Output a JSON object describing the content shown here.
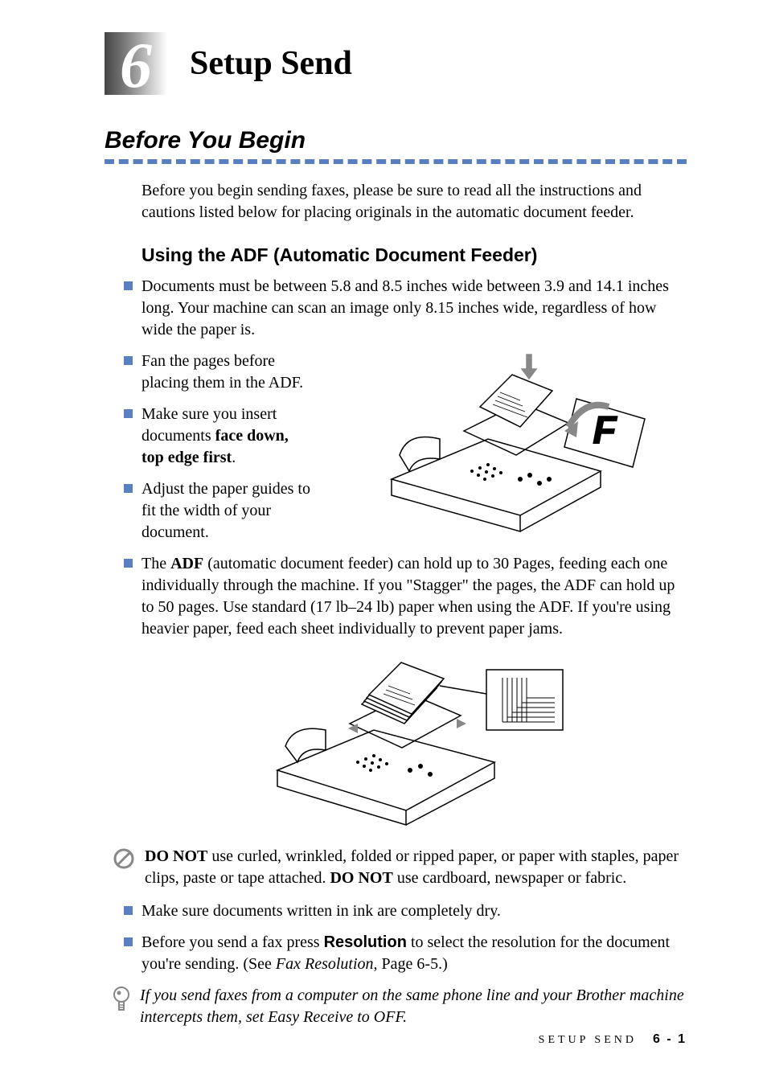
{
  "chapter": {
    "number": "6",
    "title": "Setup Send"
  },
  "section": {
    "title": "Before You Begin",
    "intro": "Before you begin sending faxes, please be sure to read all the instructions and cautions listed below for placing originals in the automatic document feeder."
  },
  "subsection": {
    "title": "Using the ADF (Automatic Document Feeder)"
  },
  "bullets": {
    "b1": "Documents must be between 5.8 and 8.5 inches wide between 3.9 and 14.1 inches long. Your machine can scan an image only 8.15 inches wide, regardless of how wide the paper is.",
    "b2": "Fan the pages before placing them in the ADF.",
    "b3_pre": "Make sure you insert documents ",
    "b3_bold": "face down, top edge first",
    "b3_post": ".",
    "b4": "Adjust the paper guides to fit the width of your document.",
    "b5_pre": "The ",
    "b5_bold": "ADF",
    "b5_post": " (automatic document feeder) can hold up to 30 Pages, feeding each one individually through the machine. If you \"Stagger\" the pages, the ADF can hold up to 50 pages. Use standard (17 lb–24 lb) paper when using the ADF. If you're using heavier paper, feed each sheet individually to prevent paper jams.",
    "b6": "Make sure documents written in ink are completely dry.",
    "b7_pre": "Before you send a fax press ",
    "b7_bold": "Resolution",
    "b7_post1": " to select the resolution for the document you're sending. (See ",
    "b7_italic": "Fax Resolution",
    "b7_post2": ", Page 6-5.)"
  },
  "prohibit": {
    "p1": "DO NOT",
    "p2": " use curled, wrinkled, folded or ripped paper, or paper with staples, paper clips, paste or tape attached. ",
    "p3": "DO NOT",
    "p4": " use cardboard, newspaper or fabric."
  },
  "note": "If you send faxes from a computer on the same phone line and your Brother machine intercepts them, set Easy Receive to OFF.",
  "figure": {
    "face_letter": "F"
  },
  "footer": {
    "running": "SETUP SEND",
    "page": "6 - 1"
  }
}
